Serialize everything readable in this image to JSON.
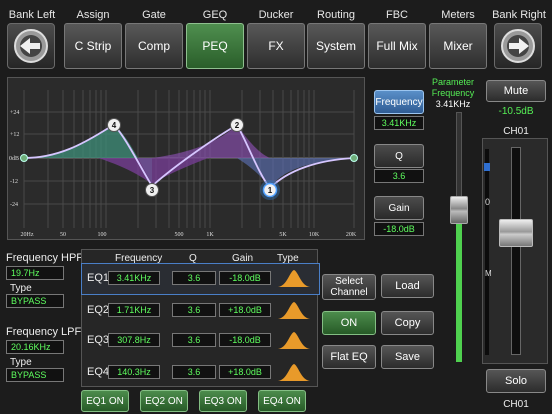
{
  "header": {
    "bank_left": "Bank Left",
    "bank_right": "Bank Right",
    "labels": [
      "Assign",
      "Gate",
      "GEQ",
      "Ducker",
      "Routing",
      "FBC",
      "Meters"
    ],
    "buttons": [
      "C Strip",
      "Comp",
      "PEQ",
      "FX",
      "System",
      "Full Mix",
      "Mixer"
    ],
    "active": "PEQ"
  },
  "graph": {
    "y_ticks": [
      "+24",
      "+12",
      "0dB",
      "-12",
      "-24"
    ],
    "x_ticks": [
      "20Hz",
      "50",
      "100",
      "500",
      "1K",
      "5K",
      "10K",
      "20K"
    ],
    "points": [
      "4",
      "2",
      "3",
      "1"
    ]
  },
  "param": {
    "title_line1": "Parameter",
    "title_line2": "Frequency",
    "title_value": "3.41KHz",
    "frequency_label": "Frequency",
    "frequency_value": "3.41KHz",
    "q_label": "Q",
    "q_value": "3.6",
    "gain_label": "Gain",
    "gain_value": "-18.0dB",
    "fader_level": 0.62
  },
  "channel": {
    "mute_label": "Mute",
    "level": "-10.5dB",
    "name": "CH01",
    "scale_zero": "0",
    "scale_m": "M",
    "solo_label": "Solo",
    "name_bottom": "CH01",
    "fader_level": 0.6
  },
  "hpf": {
    "title": "Frequency HPF",
    "frequency": "19.7Hz",
    "type_label": "Type",
    "type_value": "BYPASS"
  },
  "lpf": {
    "title": "Frequency LPF",
    "frequency": "20.16KHz",
    "type_label": "Type",
    "type_value": "BYPASS"
  },
  "eq": {
    "headers": {
      "frequency": "Frequency",
      "q": "Q",
      "gain": "Gain",
      "type": "Type"
    },
    "bands": [
      {
        "name": "EQ1",
        "frequency": "3.41KHz",
        "q": "3.6",
        "gain": "-18.0dB"
      },
      {
        "name": "EQ2",
        "frequency": "1.71KHz",
        "q": "3.6",
        "gain": "+18.0dB"
      },
      {
        "name": "EQ3",
        "frequency": "307.8Hz",
        "q": "3.6",
        "gain": "-18.0dB"
      },
      {
        "name": "EQ4",
        "frequency": "140.3Hz",
        "q": "3.6",
        "gain": "+18.0dB"
      }
    ],
    "on_buttons": [
      "EQ1 ON",
      "EQ2 ON",
      "EQ3 ON",
      "EQ4 ON"
    ]
  },
  "actions": {
    "select_channel": "Select Channel",
    "on": "ON",
    "flat_eq": "Flat EQ",
    "load": "Load",
    "copy": "Copy",
    "save": "Save"
  }
}
